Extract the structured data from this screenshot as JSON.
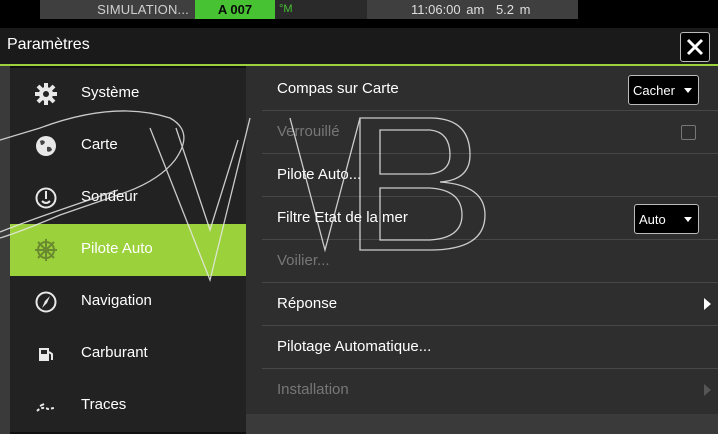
{
  "status_bar": {
    "simulation": "SIMULATION...",
    "autopilot_heading": "A 007",
    "autopilot_unit": "°M",
    "time": "11:06:00 am",
    "depth": "5.2 m"
  },
  "header": {
    "title": "Paramètres"
  },
  "sidebar": {
    "items": [
      {
        "label": "Système",
        "icon": "gear-icon"
      },
      {
        "label": "Carte",
        "icon": "globe-icon"
      },
      {
        "label": "Sondeur",
        "icon": "sonar-icon"
      },
      {
        "label": "Pilote Auto",
        "icon": "helm-icon",
        "active": true
      },
      {
        "label": "Navigation",
        "icon": "compass-icon"
      },
      {
        "label": "Carburant",
        "icon": "fuel-icon"
      },
      {
        "label": "Traces",
        "icon": "trail-icon"
      }
    ]
  },
  "content": {
    "rows": [
      {
        "label": "Compas sur Carte",
        "control": "dropdown",
        "value": "Cacher"
      },
      {
        "label": "Verrouillé",
        "control": "checkbox",
        "checked": false,
        "disabled": true
      },
      {
        "label": "Pilote Auto..."
      },
      {
        "label": "Filtre Etat de la mer",
        "control": "dropdown",
        "value": "Auto"
      },
      {
        "label": "Voilier...",
        "disabled": true
      },
      {
        "label": "Réponse",
        "control": "submenu"
      },
      {
        "label": "Pilotage Automatique..."
      },
      {
        "label": "Installation",
        "control": "submenu",
        "disabled": true
      }
    ]
  },
  "colors": {
    "accent": "#9bd13a",
    "autopilot_green": "#47c233"
  }
}
